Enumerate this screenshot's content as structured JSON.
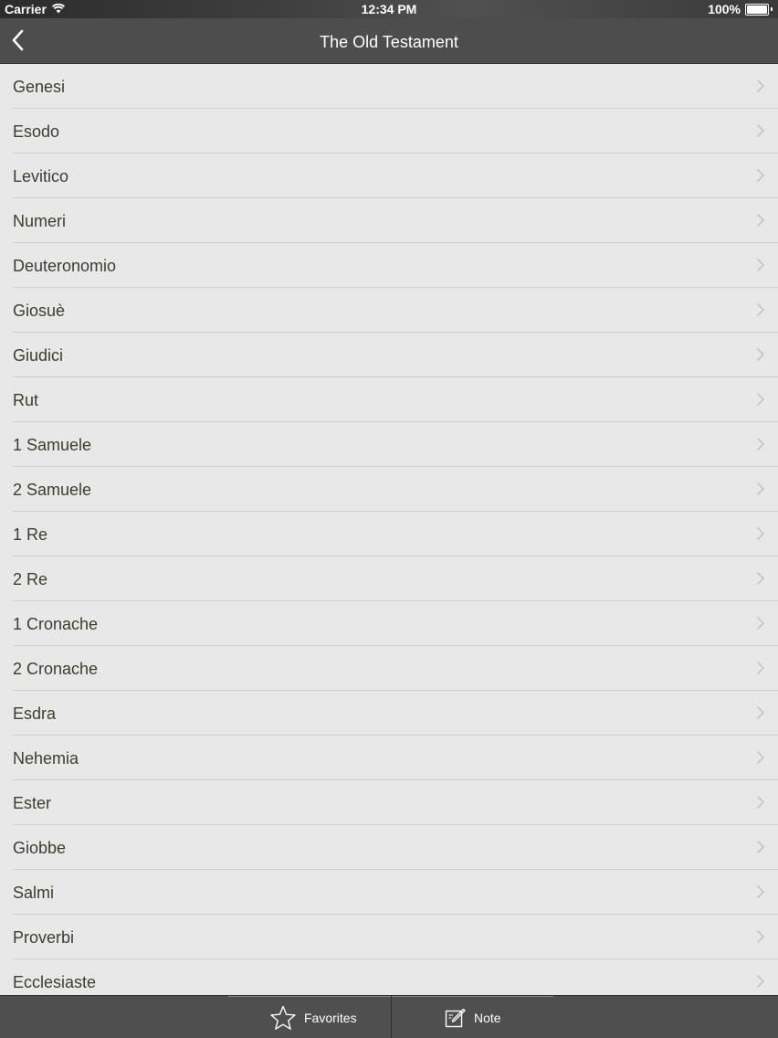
{
  "status_bar": {
    "carrier": "Carrier",
    "time": "12:34 PM",
    "battery_percent": "100%",
    "battery_level": 1.0
  },
  "nav": {
    "title": "The Old Testament",
    "back_icon": "chevron-left-icon"
  },
  "books": [
    {
      "label": "Genesi"
    },
    {
      "label": "Esodo"
    },
    {
      "label": "Levitico"
    },
    {
      "label": "Numeri"
    },
    {
      "label": "Deuteronomio"
    },
    {
      "label": "Giosuè"
    },
    {
      "label": "Giudici"
    },
    {
      "label": "Rut"
    },
    {
      "label": "1 Samuele"
    },
    {
      "label": "2 Samuele"
    },
    {
      "label": "1 Re"
    },
    {
      "label": "2 Re"
    },
    {
      "label": "1 Cronache"
    },
    {
      "label": "2 Cronache"
    },
    {
      "label": "Esdra"
    },
    {
      "label": "Nehemia"
    },
    {
      "label": "Ester"
    },
    {
      "label": "Giobbe"
    },
    {
      "label": "Salmi"
    },
    {
      "label": "Proverbi"
    },
    {
      "label": "Ecclesiaste"
    }
  ],
  "tab_bar": {
    "favorites_label": "Favorites",
    "favorites_icon": "star-icon",
    "note_label": "Note",
    "note_icon": "edit-note-icon"
  },
  "colors": {
    "nav_background": "#4d4d4d",
    "list_background": "#e9e8e8",
    "row_text": "#3d3d2e",
    "separator": "#cfcfcf",
    "chevron": "#c4c4c4"
  }
}
